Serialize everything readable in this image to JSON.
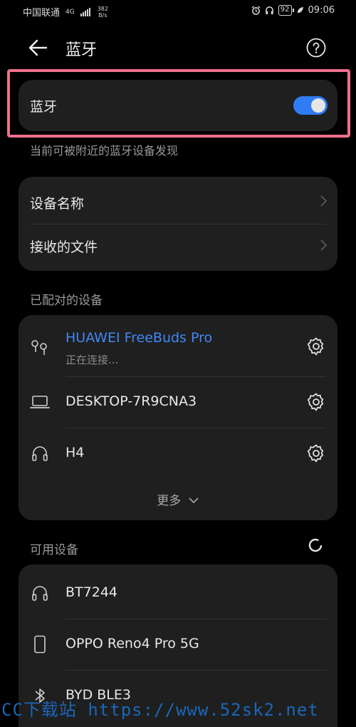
{
  "status_bar": {
    "carrier": "中国联通",
    "network": "4G",
    "net_speed_value": "382",
    "net_speed_unit": "B/s",
    "battery": "92",
    "time": "09:06"
  },
  "header": {
    "title": "蓝牙",
    "back_icon": "back-arrow-icon",
    "help_icon": "help-icon"
  },
  "bluetooth_toggle": {
    "label": "蓝牙",
    "enabled": true,
    "accent": "#2f7cf6"
  },
  "discoverable_caption": "当前可被附近的蓝牙设备发现",
  "settings_card": {
    "items": [
      {
        "label": "设备名称"
      },
      {
        "label": "接收的文件"
      }
    ]
  },
  "paired": {
    "section_label": "已配对的设备",
    "devices": [
      {
        "name": "HUAWEI FreeBuds Pro",
        "status": "正在连接...",
        "icon": "earbuds-icon",
        "name_color": "#3f88f5"
      },
      {
        "name": "DESKTOP-7R9CNA3",
        "icon": "laptop-icon"
      },
      {
        "name": "H4",
        "icon": "headphones-icon"
      }
    ],
    "more_label": "更多"
  },
  "available": {
    "section_label": "可用设备",
    "devices": [
      {
        "name": "BT7244",
        "icon": "headphones-icon"
      },
      {
        "name": "OPPO Reno4 Pro 5G",
        "icon": "phone-icon"
      },
      {
        "name": "BYD BLE3",
        "icon": "bluetooth-icon"
      }
    ]
  },
  "highlight_color": "#f0708e",
  "watermark": "CC下载站 https://www.52sk2.net"
}
